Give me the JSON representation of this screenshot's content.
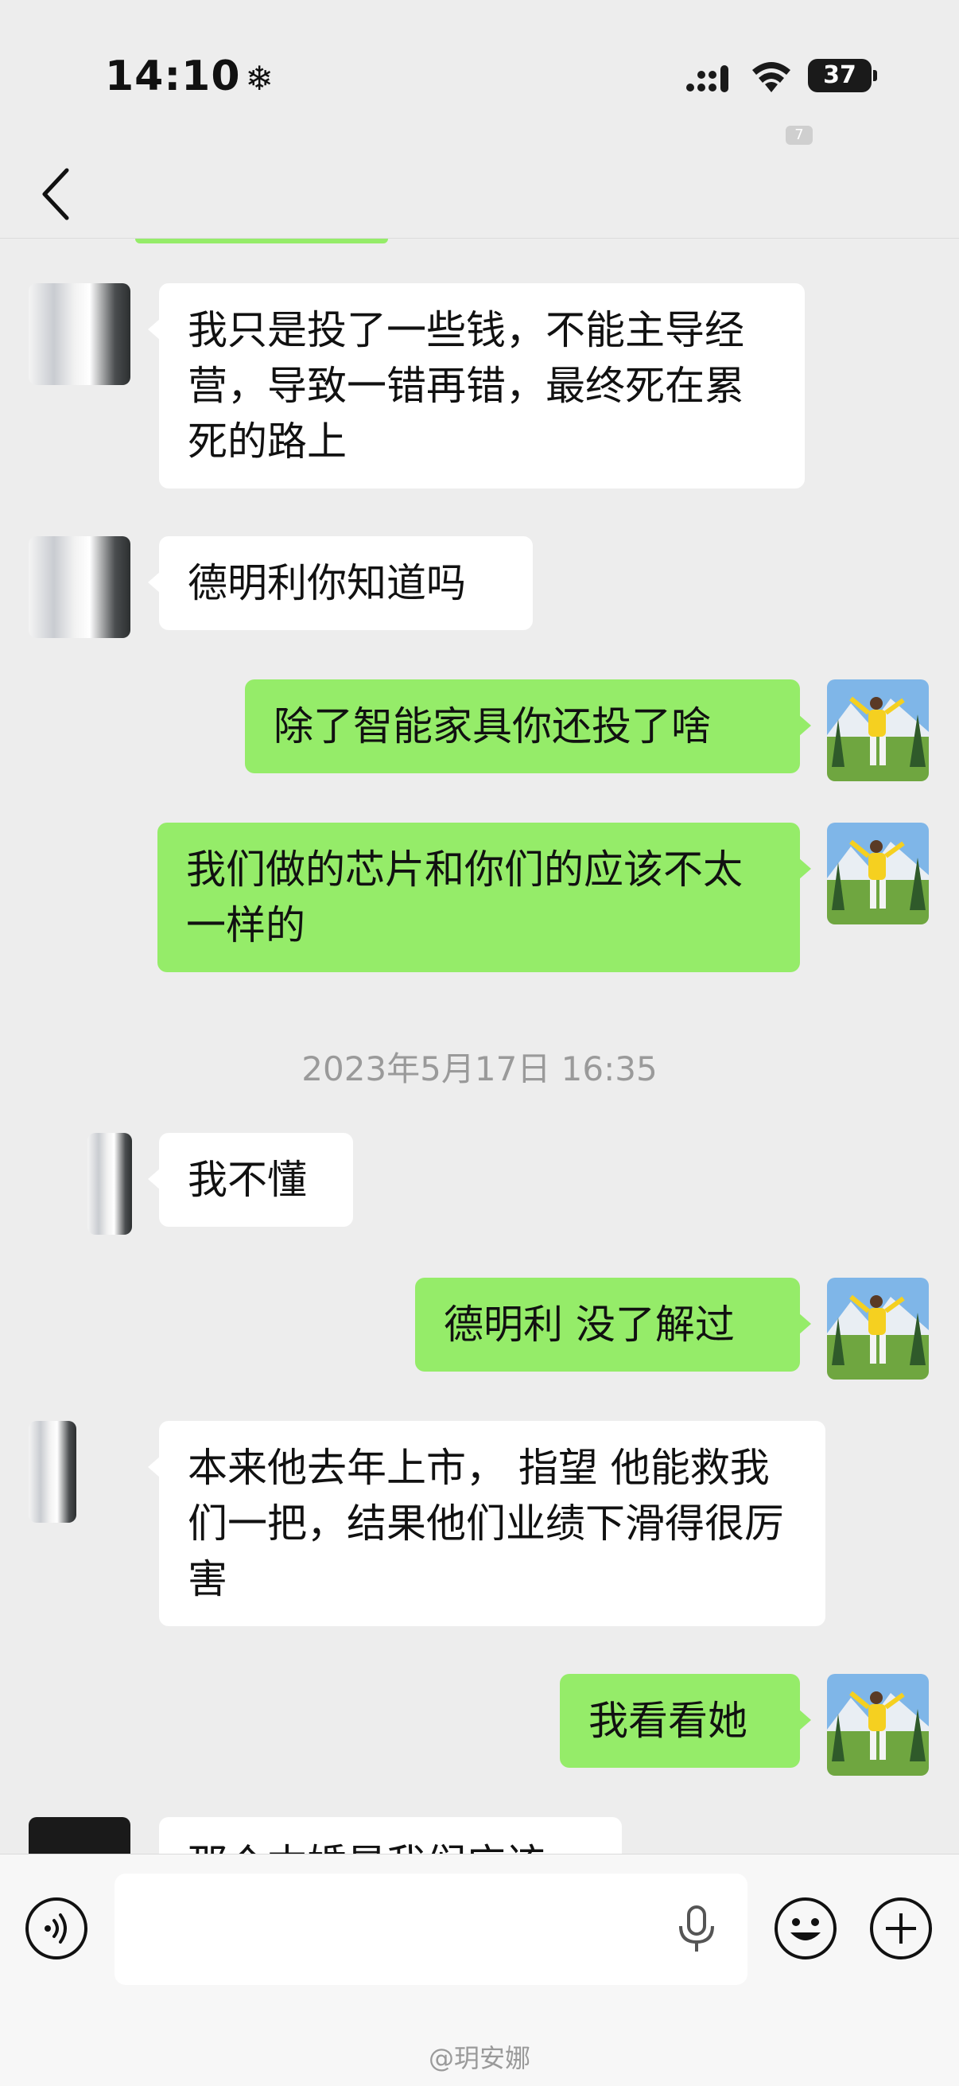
{
  "status_bar": {
    "time": "14:10",
    "battery": "37",
    "tab_badge": "7"
  },
  "messages": [
    {
      "side": "in",
      "text": "我只是投了一些钱，不能主导经营，导致一错再错，最终死在累死的路上"
    },
    {
      "side": "in",
      "text": "德明利你知道吗"
    },
    {
      "side": "out",
      "text": "除了智能家具你还投了啥"
    },
    {
      "side": "out",
      "text": "我们做的芯片和你们的应该不太一样的"
    },
    {
      "timestamp": "2023年5月17日 16:35"
    },
    {
      "side": "in",
      "text": "我不懂"
    },
    {
      "side": "out",
      "text": "德明利 没了解过"
    },
    {
      "side": "in",
      "text": "本来他去年上市， 指望 他能救我们一把，结果他们业绩下滑得很厉害"
    },
    {
      "side": "out",
      "text": "我看看她"
    },
    {
      "side": "in",
      "text": "那个本婚是我们应该"
    }
  ],
  "input": {
    "placeholder": ""
  },
  "watermark": "@玥安娜",
  "colors": {
    "background": "#ededed",
    "outgoing_bubble": "#95ec69",
    "incoming_bubble": "#ffffff"
  },
  "icons": [
    "back-icon",
    "voice-icon",
    "microphone-icon",
    "emoji-icon",
    "plus-icon",
    "signal-icon",
    "wifi-icon"
  ]
}
